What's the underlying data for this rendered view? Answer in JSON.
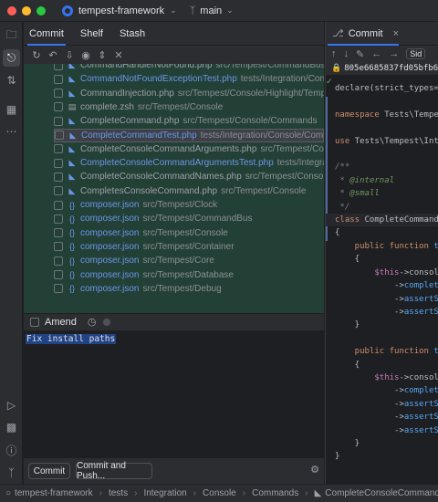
{
  "window": {
    "project_name": "tempest-framework",
    "branch_name": "main",
    "traffic_colors": [
      "#ff5f57",
      "#febc2e",
      "#28c840"
    ]
  },
  "toolstrip": {
    "icons": [
      "folder-icon",
      "commit-icon",
      "pull-requests-icon",
      "structure-icon",
      "more-icon",
      "run-icon",
      "terminal-icon",
      "problems-icon",
      "git-icon"
    ]
  },
  "commit_panel": {
    "tabs": [
      "Commit",
      "Shelf",
      "Stash"
    ],
    "toolbar_icons": [
      "refresh-icon",
      "rollback-icon",
      "update-icon",
      "eye-icon",
      "expand-icon",
      "collapse-icon"
    ],
    "files": [
      {
        "name": "CommandHandlerNotFound.php",
        "path": "src/Tempest/CommandBus",
        "type": "php",
        "status": "plain"
      },
      {
        "name": "CommandNotFoundExceptionTest.php",
        "path": "tests/Integration/Console/Exc",
        "type": "php",
        "status": "added"
      },
      {
        "name": "CommandInjection.php",
        "path": "src/Tempest/Console/Highlight/TempestCons",
        "type": "php",
        "status": "plain"
      },
      {
        "name": "complete.zsh",
        "path": "src/Tempest/Console",
        "type": "zsh",
        "status": "plain"
      },
      {
        "name": "CompleteCommand.php",
        "path": "src/Tempest/Console/Commands",
        "type": "php",
        "status": "plain"
      },
      {
        "name": "CompleteCommandTest.php",
        "path": "tests/Integration/Console/Commands",
        "type": "php",
        "status": "added",
        "selected": true
      },
      {
        "name": "CompleteConsoleCommandArguments.php",
        "path": "src/Tempest/Console/Acti",
        "type": "php",
        "status": "plain"
      },
      {
        "name": "CompleteConsoleCommandArgumentsTest.php",
        "path": "tests/Integration/Cons",
        "type": "php",
        "status": "added"
      },
      {
        "name": "CompleteConsoleCommandNames.php",
        "path": "src/Tempest/Console/Actions",
        "type": "php",
        "status": "plain"
      },
      {
        "name": "CompletesConsoleCommand.php",
        "path": "src/Tempest/Console",
        "type": "php",
        "status": "plain"
      },
      {
        "name": "composer.json",
        "path": "src/Tempest/Clock",
        "type": "json",
        "status": "modified"
      },
      {
        "name": "composer.json",
        "path": "src/Tempest/CommandBus",
        "type": "json",
        "status": "modified"
      },
      {
        "name": "composer.json",
        "path": "src/Tempest/Console",
        "type": "json",
        "status": "modified"
      },
      {
        "name": "composer.json",
        "path": "src/Tempest/Container",
        "type": "json",
        "status": "modified"
      },
      {
        "name": "composer.json",
        "path": "src/Tempest/Core",
        "type": "json",
        "status": "modified"
      },
      {
        "name": "composer.json",
        "path": "src/Tempest/Database",
        "type": "json",
        "status": "modified"
      },
      {
        "name": "composer.json",
        "path": "src/Tempest/Debug",
        "type": "json",
        "status": "modified"
      }
    ],
    "amend_label": "Amend",
    "commit_message": "Fix install paths",
    "commit_button": "Commit",
    "commit_push_button": "Commit and Push..."
  },
  "editor": {
    "tab_label": "Commit",
    "side_button": "Sid",
    "commit_hash": "805e6685837fd05bfb6263b",
    "code_lines": [
      [
        {
          "t": "declare(strict_types=1)",
          "c": "plain"
        }
      ],
      [],
      [
        {
          "t": "namespace ",
          "c": "kw"
        },
        {
          "t": "Tests\\Tempest",
          "c": "plain"
        }
      ],
      [],
      [
        {
          "t": "use ",
          "c": "kw"
        },
        {
          "t": "Tests\\Tempest\\Integ",
          "c": "plain"
        }
      ],
      [],
      [
        {
          "t": "/**",
          "c": "cm"
        }
      ],
      [
        {
          "t": " * ",
          "c": "cm"
        },
        {
          "t": "@internal",
          "c": "tag"
        }
      ],
      [
        {
          "t": " * ",
          "c": "cm"
        },
        {
          "t": "@small",
          "c": "tag"
        }
      ],
      [
        {
          "t": " */",
          "c": "cm"
        }
      ],
      [
        {
          "t": "class ",
          "c": "kw"
        },
        {
          "t": "CompleteCommandTes",
          "c": "plain"
        }
      ],
      [
        {
          "t": "{",
          "c": "plain"
        }
      ],
      [
        {
          "t": "    public function ",
          "c": "kw"
        },
        {
          "t": "test",
          "c": "fn"
        }
      ],
      [
        {
          "t": "    {",
          "c": "plain"
        }
      ],
      [
        {
          "t": "        ",
          "c": "plain"
        },
        {
          "t": "$this",
          "c": "var"
        },
        {
          "t": "->console",
          "c": "plain"
        }
      ],
      [
        {
          "t": "            ->",
          "c": "plain"
        },
        {
          "t": "complete(",
          "c": "fn"
        }
      ],
      [
        {
          "t": "            ->",
          "c": "plain"
        },
        {
          "t": "assertSee",
          "c": "fn"
        }
      ],
      [
        {
          "t": "            ->",
          "c": "plain"
        },
        {
          "t": "assertSee",
          "c": "fn"
        }
      ],
      [
        {
          "t": "    }",
          "c": "plain"
        }
      ],
      [],
      [
        {
          "t": "    public function ",
          "c": "kw"
        },
        {
          "t": "test",
          "c": "fn"
        }
      ],
      [
        {
          "t": "    {",
          "c": "plain"
        }
      ],
      [
        {
          "t": "        ",
          "c": "plain"
        },
        {
          "t": "$this",
          "c": "var"
        },
        {
          "t": "->console",
          "c": "plain"
        }
      ],
      [
        {
          "t": "            ->",
          "c": "plain"
        },
        {
          "t": "complete(",
          "c": "fn"
        }
      ],
      [
        {
          "t": "            ->",
          "c": "plain"
        },
        {
          "t": "assertSee",
          "c": "fn"
        }
      ],
      [
        {
          "t": "            ->",
          "c": "plain"
        },
        {
          "t": "assertSee",
          "c": "fn"
        }
      ],
      [
        {
          "t": "            ->",
          "c": "plain"
        },
        {
          "t": "assertSee",
          "c": "fn"
        }
      ],
      [
        {
          "t": "    }",
          "c": "plain"
        }
      ],
      [
        {
          "t": "}",
          "c": "plain"
        }
      ]
    ]
  },
  "statusbar": {
    "crumbs": [
      "tempest-framework",
      "tests",
      "Integration",
      "Console",
      "Commands",
      "CompleteConsoleCommandTest.php",
      "Comp"
    ]
  }
}
